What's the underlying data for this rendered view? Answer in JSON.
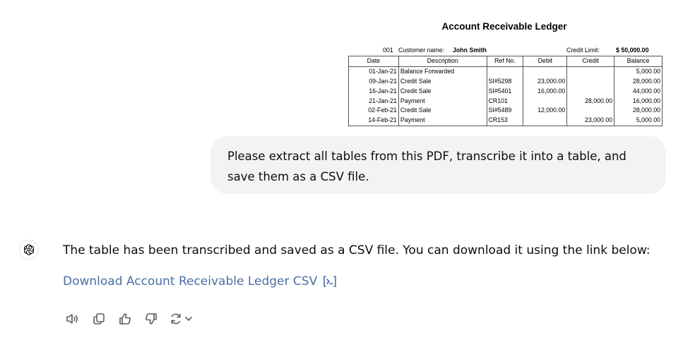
{
  "ledger": {
    "title": "Account Receivable Ledger",
    "customer_no": "001",
    "customer_label": "Customer name:",
    "customer_name": "John Smith",
    "credit_limit_label": "Credit Limit:",
    "credit_limit_value": "$ 50,000.00",
    "headers": [
      "Date",
      "Description",
      "Ref No.",
      "Debit",
      "Credit",
      "Balance"
    ],
    "rows": [
      [
        "01-Jan-21",
        "Balance Forwarded",
        "",
        "",
        "",
        "5,000.00"
      ],
      [
        "09-Jan-21",
        "Credit Sale",
        "SI#5298",
        "23,000.00",
        "",
        "28,000.00"
      ],
      [
        "16-Jan-21",
        "Credit Sale",
        "SI#5401",
        "16,000.00",
        "",
        "44,000.00"
      ],
      [
        "21-Jan-21",
        "Payment",
        "CR101",
        "",
        "28,000.00",
        "16,000.00"
      ],
      [
        "02-Feb-21",
        "Credit Sale",
        "SI#5489",
        "12,000.00",
        "",
        "28,000.00"
      ],
      [
        "14-Feb-21",
        "Payment",
        "CR153",
        "",
        "23,000.00",
        "5,000.00"
      ]
    ]
  },
  "user_message": "Please extract all tables from this PDF, transcribe it into a table, and save them as a CSV file.",
  "assistant": {
    "message": "The table has been transcribed and saved as a CSV file. You can download it using the link below:",
    "link_text": "Download Account Receivable Ledger CSV",
    "icons": {
      "avatar": "openai-logo-icon",
      "link": "code-interpreter-icon",
      "read_aloud": "speaker-icon",
      "copy": "copy-icon",
      "good": "thumbs-up-icon",
      "bad": "thumbs-down-icon",
      "regenerate": "regenerate-icon",
      "more": "chevron-down-icon"
    }
  }
}
